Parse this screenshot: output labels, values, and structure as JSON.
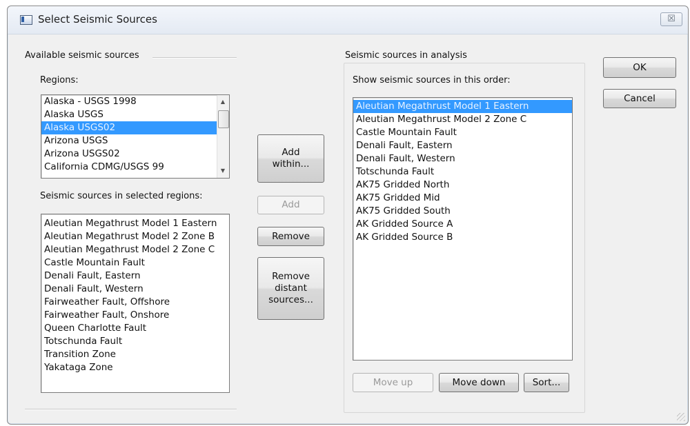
{
  "window": {
    "title": "Select Seismic Sources",
    "close_label": "☒"
  },
  "available": {
    "group_label": "Available seismic sources",
    "regions_label": "Regions:",
    "regions": [
      {
        "label": "Alaska - USGS 1998",
        "selected": false
      },
      {
        "label": "Alaska USGS",
        "selected": false
      },
      {
        "label": "Alaska USGS02",
        "selected": true
      },
      {
        "label": "Arizona USGS",
        "selected": false
      },
      {
        "label": "Arizona USGS02",
        "selected": false
      },
      {
        "label": "California CDMG/USGS 99",
        "selected": false
      }
    ],
    "sources_label": "Seismic sources in selected regions:",
    "sources": [
      "Aleutian Megathrust Model 1 Eastern",
      "Aleutian Megathrust Model 2 Zone B",
      "Aleutian Megathrust Model 2 Zone C",
      "Castle Mountain Fault",
      "Denali Fault, Eastern",
      "Denali Fault, Western",
      "Fairweather Fault, Offshore",
      "Fairweather Fault, Onshore",
      "Queen Charlotte Fault",
      "Totschunda Fault",
      "Transition Zone",
      "Yakataga Zone"
    ]
  },
  "middle_buttons": {
    "add_within": "Add\nwithin...",
    "add": "Add",
    "remove": "Remove",
    "remove_distant": "Remove\ndistant\nsources..."
  },
  "analysis": {
    "group_label": "Seismic sources in analysis",
    "order_label": "Show seismic sources in this order:",
    "sources": [
      {
        "label": "Aleutian Megathrust Model 1 Eastern",
        "selected": true
      },
      {
        "label": "Aleutian Megathrust Model 2 Zone C",
        "selected": false
      },
      {
        "label": "Castle Mountain Fault",
        "selected": false
      },
      {
        "label": "Denali Fault, Eastern",
        "selected": false
      },
      {
        "label": "Denali Fault, Western",
        "selected": false
      },
      {
        "label": "Totschunda Fault",
        "selected": false
      },
      {
        "label": "AK75 Gridded North",
        "selected": false
      },
      {
        "label": "AK75 Gridded Mid",
        "selected": false
      },
      {
        "label": "AK75 Gridded South",
        "selected": false
      },
      {
        "label": "AK Gridded Source A",
        "selected": false
      },
      {
        "label": "AK Gridded Source B",
        "selected": false
      }
    ],
    "move_up": "Move up",
    "move_down": "Move down",
    "sort": "Sort..."
  },
  "dialog_buttons": {
    "ok": "OK",
    "cancel": "Cancel"
  },
  "colors": {
    "selection": "#3399ff",
    "dialog_bg": "#f0f0f0"
  }
}
